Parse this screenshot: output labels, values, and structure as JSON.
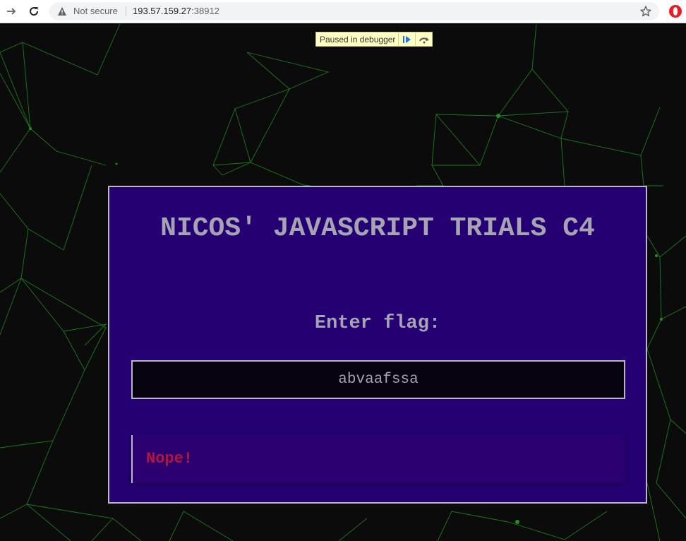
{
  "browser": {
    "security_label": "Not secure",
    "url_host": "193.57.159.27",
    "url_port": ":38912"
  },
  "debugger": {
    "label": "Paused in debugger"
  },
  "card": {
    "title": "NICOS' JAVASCRIPT TRIALS C4",
    "prompt": "Enter flag:",
    "flag_value": "abvaafssa",
    "result": "Nope!"
  },
  "colors": {
    "background": "#0b0b0b",
    "network_lines": "#1f8f1f",
    "card_bg": "#240073",
    "card_text": "#a6a4b3",
    "error_text": "#b4163f"
  }
}
